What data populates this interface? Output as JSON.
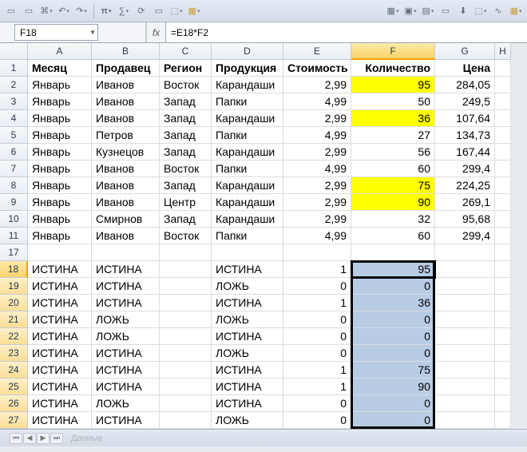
{
  "toolbar_icons": [
    "□",
    "□",
    "⌘",
    "⎌",
    "↻",
    "π",
    "∑",
    "⟳",
    "□",
    "⬚",
    "▦",
    "",
    "",
    "▦",
    "▣",
    "▤",
    "□",
    "⇩",
    "⬚",
    "∿",
    "▦"
  ],
  "namebox": "F18",
  "fx_label": "fx",
  "formula": "=E18*F2",
  "columns": [
    "A",
    "B",
    "C",
    "D",
    "E",
    "F",
    "G",
    "H"
  ],
  "header_row": [
    "Месяц",
    "Продавец",
    "Регион",
    "Продукция",
    "Стоимость",
    "Количество",
    "Цена"
  ],
  "rows": [
    {
      "n": 2,
      "a": "Январь",
      "b": "Иванов",
      "c": "Восток",
      "d": "Карандаши",
      "e": "2,99",
      "f": "95",
      "g": "284,05",
      "fhi": true
    },
    {
      "n": 3,
      "a": "Январь",
      "b": "Иванов",
      "c": "Запад",
      "d": "Папки",
      "e": "4,99",
      "f": "50",
      "g": "249,5",
      "fhi": false
    },
    {
      "n": 4,
      "a": "Январь",
      "b": "Иванов",
      "c": "Запад",
      "d": "Карандаши",
      "e": "2,99",
      "f": "36",
      "g": "107,64",
      "fhi": true
    },
    {
      "n": 5,
      "a": "Январь",
      "b": "Петров",
      "c": "Запад",
      "d": "Папки",
      "e": "4,99",
      "f": "27",
      "g": "134,73",
      "fhi": false
    },
    {
      "n": 6,
      "a": "Январь",
      "b": "Кузнецов",
      "c": "Запад",
      "d": "Карандаши",
      "e": "2,99",
      "f": "56",
      "g": "167,44",
      "fhi": false
    },
    {
      "n": 7,
      "a": "Январь",
      "b": "Иванов",
      "c": "Восток",
      "d": "Папки",
      "e": "4,99",
      "f": "60",
      "g": "299,4",
      "fhi": false
    },
    {
      "n": 8,
      "a": "Январь",
      "b": "Иванов",
      "c": "Запад",
      "d": "Карандаши",
      "e": "2,99",
      "f": "75",
      "g": "224,25",
      "fhi": true
    },
    {
      "n": 9,
      "a": "Январь",
      "b": "Иванов",
      "c": "Центр",
      "d": "Карандаши",
      "e": "2,99",
      "f": "90",
      "g": "269,1",
      "fhi": true
    },
    {
      "n": 10,
      "a": "Январь",
      "b": "Смирнов",
      "c": "Запад",
      "d": "Карандаши",
      "e": "2,99",
      "f": "32",
      "g": "95,68",
      "fhi": false
    },
    {
      "n": 11,
      "a": "Январь",
      "b": "Иванов",
      "c": "Восток",
      "d": "Папки",
      "e": "4,99",
      "f": "60",
      "g": "299,4",
      "fhi": false
    }
  ],
  "gap_row": 17,
  "logic_rows": [
    {
      "n": 18,
      "a": "ИСТИНА",
      "b": "ИСТИНА",
      "d": "ИСТИНА",
      "e": "1",
      "f": "95"
    },
    {
      "n": 19,
      "a": "ИСТИНА",
      "b": "ИСТИНА",
      "d": "ЛОЖЬ",
      "e": "0",
      "f": "0"
    },
    {
      "n": 20,
      "a": "ИСТИНА",
      "b": "ИСТИНА",
      "d": "ИСТИНА",
      "e": "1",
      "f": "36"
    },
    {
      "n": 21,
      "a": "ИСТИНА",
      "b": "ЛОЖЬ",
      "d": "ЛОЖЬ",
      "e": "0",
      "f": "0"
    },
    {
      "n": 22,
      "a": "ИСТИНА",
      "b": "ЛОЖЬ",
      "d": "ИСТИНА",
      "e": "0",
      "f": "0"
    },
    {
      "n": 23,
      "a": "ИСТИНА",
      "b": "ИСТИНА",
      "d": "ЛОЖЬ",
      "e": "0",
      "f": "0"
    },
    {
      "n": 24,
      "a": "ИСТИНА",
      "b": "ИСТИНА",
      "d": "ИСТИНА",
      "e": "1",
      "f": "75"
    },
    {
      "n": 25,
      "a": "ИСТИНА",
      "b": "ИСТИНА",
      "d": "ИСТИНА",
      "e": "1",
      "f": "90"
    },
    {
      "n": 26,
      "a": "ИСТИНА",
      "b": "ЛОЖЬ",
      "d": "ИСТИНА",
      "e": "0",
      "f": "0"
    },
    {
      "n": 27,
      "a": "ИСТИНА",
      "b": "ИСТИНА",
      "d": "ЛОЖЬ",
      "e": "0",
      "f": "0"
    }
  ],
  "sheet_tab": "Данные",
  "active_cell_row": 18,
  "selection_col": "F"
}
